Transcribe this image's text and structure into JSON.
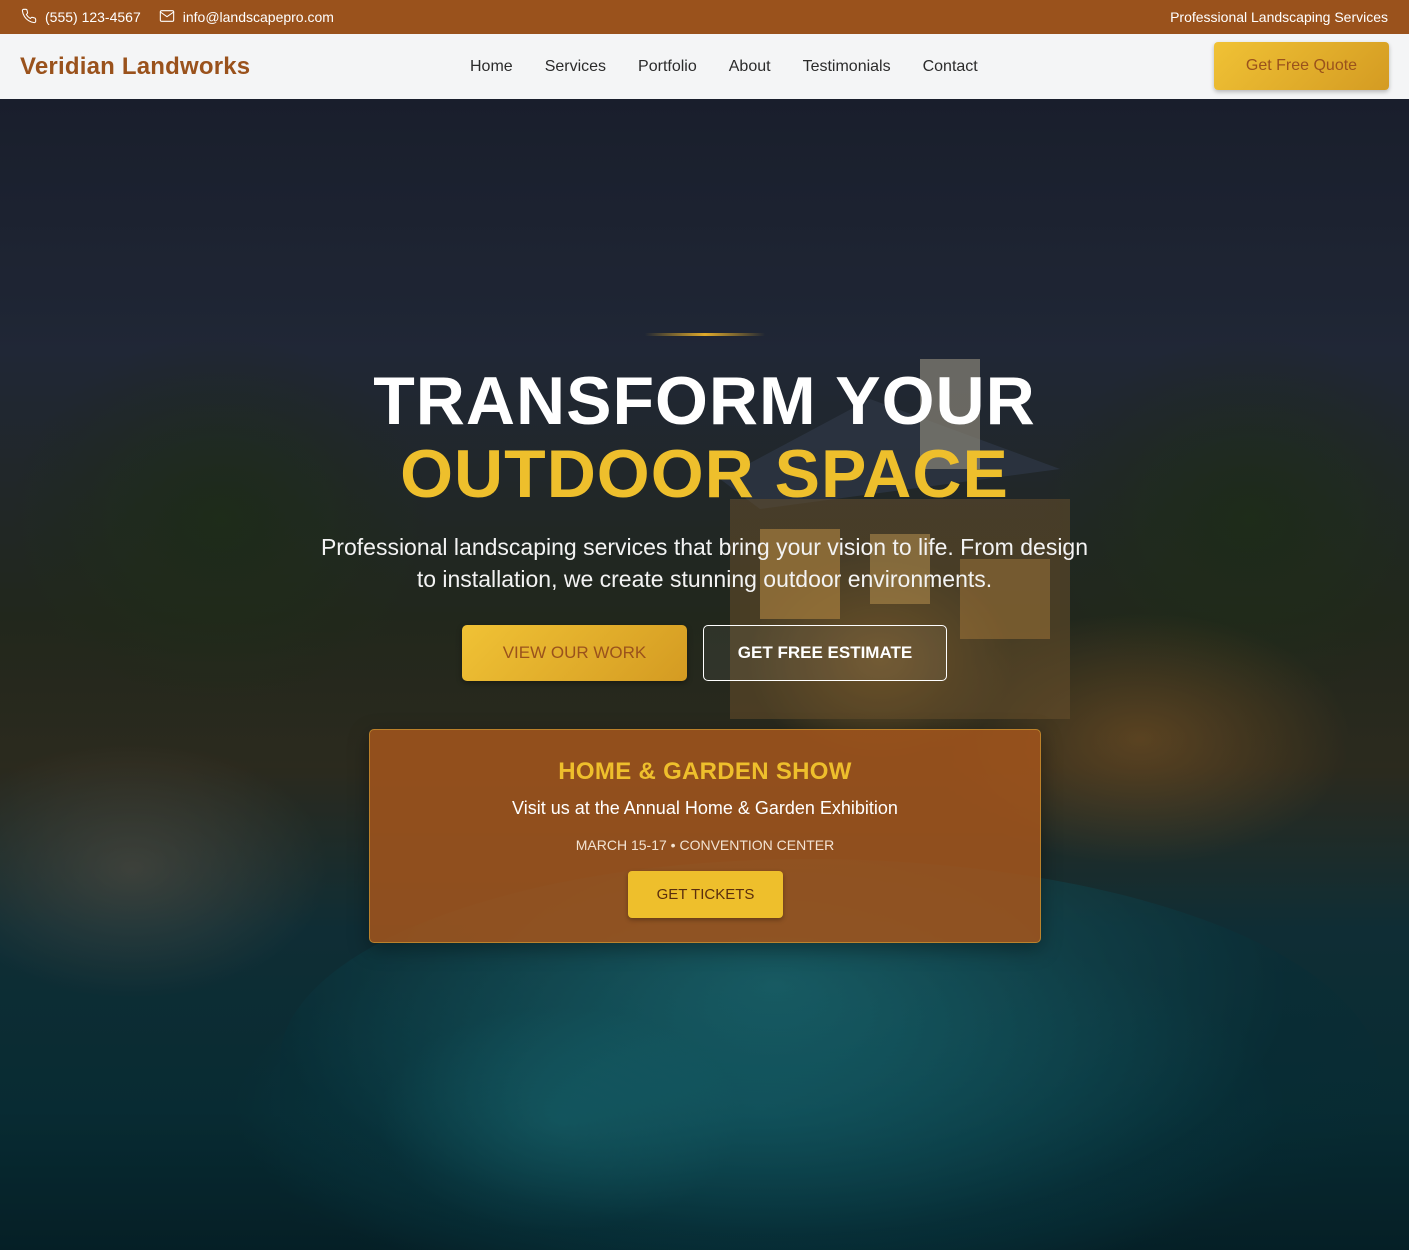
{
  "topbar": {
    "phone": "(555) 123-4567",
    "email": "info@landscapepro.com",
    "tagline": "Professional Landscaping Services"
  },
  "nav": {
    "brand": "Veridian Landworks",
    "items": [
      "Home",
      "Services",
      "Portfolio",
      "About",
      "Testimonials",
      "Contact"
    ],
    "cta": "Get Free Quote"
  },
  "hero": {
    "title_line1": "TRANSFORM YOUR",
    "title_line2": "OUTDOOR SPACE",
    "subtitle": "Professional landscaping services that bring your vision to life. From design to installation, we create stunning outdoor environments.",
    "primary_button": "VIEW OUR WORK",
    "secondary_button": "GET FREE ESTIMATE"
  },
  "event": {
    "title": "HOME & GARDEN SHOW",
    "subtitle": "Visit us at the Annual Home & Garden Exhibition",
    "details": "MARCH 15-17 • CONVENTION CENTER",
    "button": "GET TICKETS"
  },
  "colors": {
    "brand_brown": "#9a521c",
    "accent_gold": "#eebf2c",
    "nav_background": "#f4f5f6"
  },
  "icons": {
    "phone": "phone-icon",
    "email": "mail-icon"
  }
}
